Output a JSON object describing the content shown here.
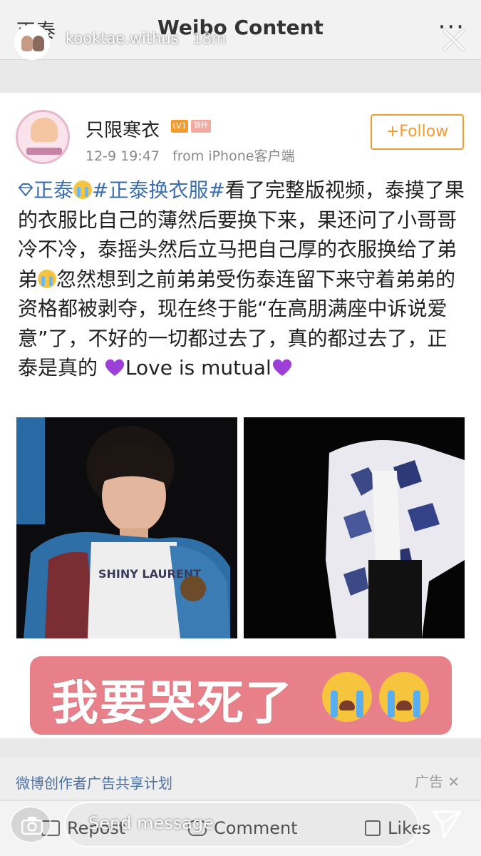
{
  "weibo_header": {
    "back_label": "正泰",
    "title": "Weibo Content",
    "more": "···"
  },
  "story": {
    "username": "kooktae.withus",
    "time": "18m",
    "message_placeholder": "Send message"
  },
  "post": {
    "author": "只限寒衣",
    "level_badge": "LV1",
    "fan_badge": "铁杆",
    "timestamp": "12-9 19:47",
    "source": "from iPhone客户端",
    "follow_label": "+Follow",
    "text": {
      "tag1": "正泰",
      "tag2": "#正泰换衣服#",
      "p1": "看了完整版视频，泰摸了果的衣服比自己的薄然后要换下来，果还问了小哥哥冷不冷，泰摇头然后立马把自己厚的衣服换给了弟弟",
      "p2": "忽然想到之前弟弟受伤泰连留下来守着弟弟的资格都被剥夺，现在终于能“在高朋满座中诉说爱意”了，不好的一切都过去了，真的都过去了，正泰是真的 ",
      "p3": "Love is mutual"
    },
    "photo_text": "SHINY LAURENT",
    "banner_text": "我要哭死了"
  },
  "ad": {
    "text": "微博创作者广告共享计划",
    "label": "广告"
  },
  "actions": {
    "repost": "Repost",
    "comment": "Comment",
    "likes": "Likes"
  },
  "colors": {
    "link_blue": "#3c6fb0",
    "follow_orange": "#f29b2f",
    "banner_pink": "#e8808a",
    "heart_purple": "#9b3fd6"
  }
}
